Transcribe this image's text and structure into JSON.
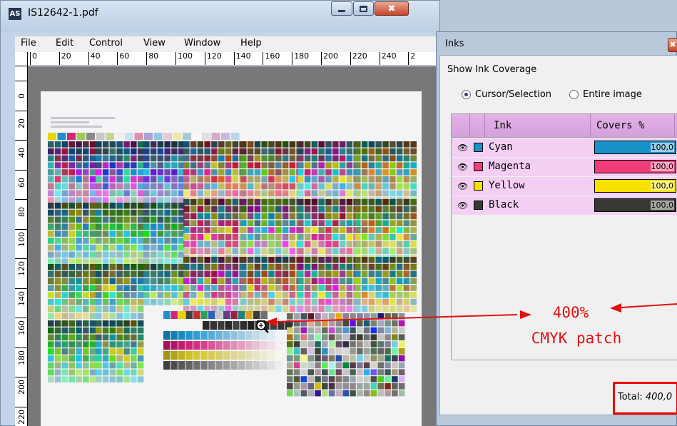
{
  "main_window": {
    "app_icon": "AS",
    "title": "IS12642-1.pdf",
    "controls": {
      "minimize": "minimize-icon",
      "maximize": "maximize-icon",
      "close": "✖"
    }
  },
  "menu": {
    "file": "File",
    "edit": "Edit",
    "control": "Control",
    "view": "View",
    "window": "Window",
    "help": "Help"
  },
  "ruler": {
    "top": [
      "0",
      "20",
      "40",
      "60",
      "80",
      "100",
      "120",
      "140",
      "160",
      "180",
      "200",
      "220",
      "240",
      "2"
    ],
    "left": [
      "0",
      "20",
      "40",
      "60",
      "80",
      "100",
      "120",
      "140",
      "160",
      "180",
      "200",
      "220"
    ]
  },
  "inks_panel": {
    "title": "Inks",
    "close": "✖",
    "show_coverage": "Show Ink Coverage",
    "radio_cursor": "Cursor/Selection",
    "radio_entire": "Entire image",
    "col_ink": "Ink",
    "col_covers": "Covers %",
    "inks": [
      {
        "name": "Cyan",
        "value": "100,0",
        "fraction": 1.0,
        "color": "#1892c8"
      },
      {
        "name": "Magenta",
        "value": "100,0",
        "fraction": 1.0,
        "color": "#f03c78"
      },
      {
        "name": "Yellow",
        "value": "100,0",
        "fraction": 1.0,
        "color": "#f8e000"
      },
      {
        "name": "Black",
        "value": "100,0",
        "fraction": 1.0,
        "color": "#383832"
      }
    ],
    "total_label": "Total:",
    "total_value": "400,0"
  },
  "annotation": {
    "line1": "400%",
    "line2": "CMYK patch",
    "color": "#e01010"
  },
  "icons": {
    "eye": "eye-icon",
    "zoom_cursor": "zoom-cursor-icon"
  }
}
